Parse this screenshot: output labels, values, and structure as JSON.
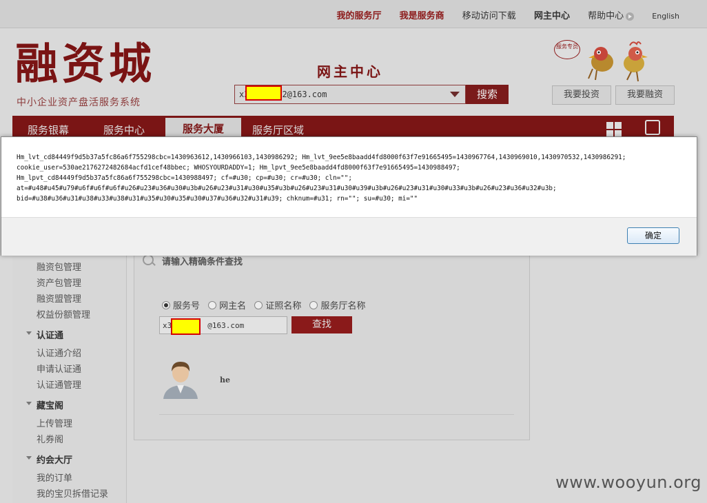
{
  "topbar": {
    "links": [
      "我的服务厅",
      "我是服务商",
      "移动访问下载",
      "网主中心",
      "帮助中心",
      "English"
    ]
  },
  "header": {
    "logo": "融资城",
    "logo_subtitle": "中小企业资产盘活服务系统",
    "center_title": "网主中心",
    "search_value_prefix": "x3",
    "search_value_suffix": "2@163.com",
    "search_button": "搜索",
    "service_tag": "服务专员",
    "invest_button": "我要投资",
    "finance_button": "我要融资"
  },
  "nav": {
    "items": [
      "服务银幕",
      "服务中心",
      "服务大厦",
      "服务厅区域"
    ],
    "active": "服务大厦"
  },
  "sidebar": {
    "items_top": [
      "融资包管理",
      "资产包管理",
      "融资盟管理",
      "权益份额管理"
    ],
    "section_cert": "认证通",
    "items_cert": [
      "认证通介绍",
      "申请认证通",
      "认证通管理"
    ],
    "section_treasure": "藏宝阁",
    "items_treasure": [
      "上传管理",
      "礼券阁"
    ],
    "section_meet": "约会大厅",
    "items_meet": [
      "我的订单",
      "我的宝贝拆借记录"
    ]
  },
  "panel": {
    "hint": "请输入精确条件查找",
    "radio_options": [
      "服务号",
      "网主名",
      "证照名称",
      "服务厅名称"
    ],
    "query_prefix": "x3",
    "query_suffix": "@163.com",
    "query_button": "查找",
    "result_name": "he"
  },
  "dialog": {
    "lines": [
      "Hm_lvt_cd84449f9d5b37a5fc86a6f755298cbc=1430963612,1430966103,1430986292; Hm_lvt_9ee5e8baadd4fd8000f63f7e91665495=1430967764,1430969010,1430970532,1430986291;",
      "cookie_user=530ae2176272482684acfd1cef48bbec; WHOSYOURDADDY=1; Hm_lpvt_9ee5e8baadd4fd8000f63f7e91665495=1430988497;",
      "Hm_lpvt_cd84449f9d5b37a5fc86a6f755298cbc=1430988497; cf=#u30; cp=#u30; cr=#u30; cln=\"\";",
      "at=#u48#u45#u79#u6f#u6f#u6f#u26#u23#u36#u30#u3b#u26#u23#u31#u30#u35#u3b#u26#u23#u31#u30#u39#u3b#u26#u23#u31#u30#u33#u3b#u26#u23#u36#u32#u3b;",
      "bid=#u38#u36#u31#u38#u33#u38#u31#u35#u30#u35#u30#u37#u36#u32#u31#u39; chknum=#u31; rn=\"\"; su=#u30; mi=\"\""
    ],
    "ok_button": "确定"
  },
  "watermark": "www.wooyun.org",
  "colors": {
    "brand_red": "#7a1515",
    "redact_fill": "#ffff00",
    "redact_border": "#d40000"
  }
}
